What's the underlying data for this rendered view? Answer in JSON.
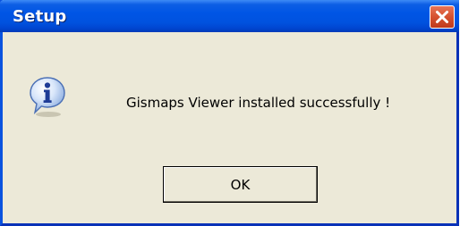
{
  "dialog": {
    "title": "Setup",
    "message": "Gismaps Viewer installed successfully !",
    "ok_label": "OK",
    "icon": "info-icon",
    "close_icon": "close-icon"
  },
  "colors": {
    "titlebar": "#0055E5",
    "background": "#ECE9D8",
    "close_button": "#D5502F"
  }
}
